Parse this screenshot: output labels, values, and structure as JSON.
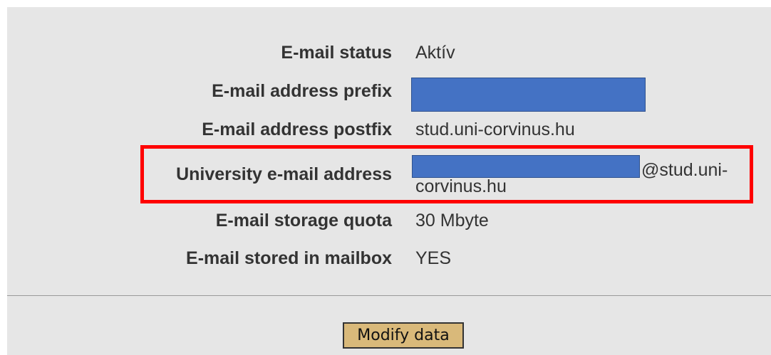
{
  "fields": [
    {
      "label": "E-mail status",
      "value": "Aktív"
    },
    {
      "label": "E-mail address prefix",
      "value": ""
    },
    {
      "label": "E-mail address postfix",
      "value": "stud.uni-corvinus.hu"
    },
    {
      "label": "University e-mail address",
      "value_line1": "@stud.uni-",
      "value_line2": "corvinus.hu"
    },
    {
      "label": "E-mail storage quota",
      "value": "30 Mbyte"
    },
    {
      "label": "E-mail stored in mailbox",
      "value": "YES"
    }
  ],
  "actions": {
    "modify_label": "Modify data"
  },
  "colors": {
    "redaction": "#4472c4",
    "highlight": "#ff0000",
    "button_bg": "#d9b97a",
    "panel_bg": "#e6e6e6"
  }
}
